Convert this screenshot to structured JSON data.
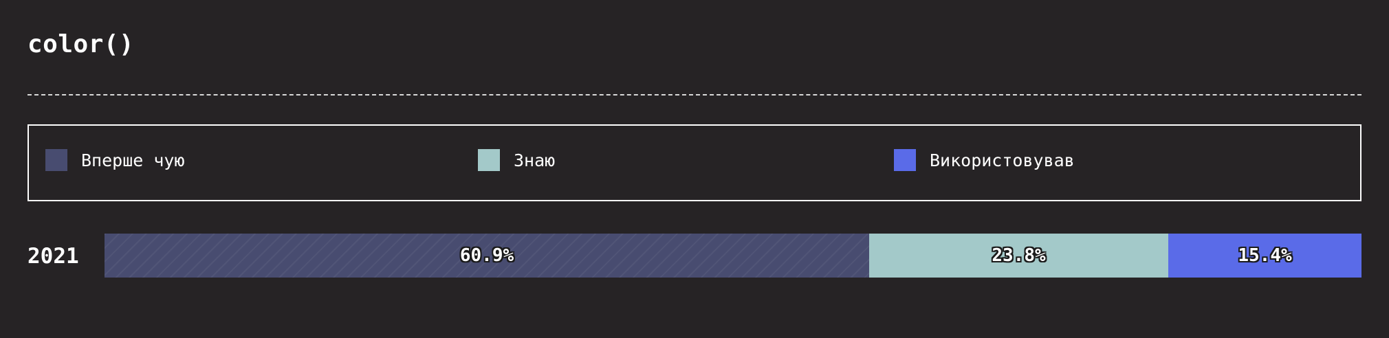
{
  "title": "color()",
  "chart_data": {
    "type": "bar",
    "orientation": "horizontal",
    "stacked": true,
    "normalized": true,
    "categories": [
      "2021"
    ],
    "series": [
      {
        "name": "Вперше чую",
        "values": [
          60.9
        ],
        "color": "#484c70",
        "pattern": "hatched",
        "label": "60.9%"
      },
      {
        "name": "Знаю",
        "values": [
          23.8
        ],
        "color": "#a3c9c9",
        "label": "23.8%"
      },
      {
        "name": "Використовував",
        "values": [
          15.4
        ],
        "color": "#5a6be8",
        "label": "15.4%"
      }
    ],
    "unit": "%",
    "legend_position": "top"
  }
}
